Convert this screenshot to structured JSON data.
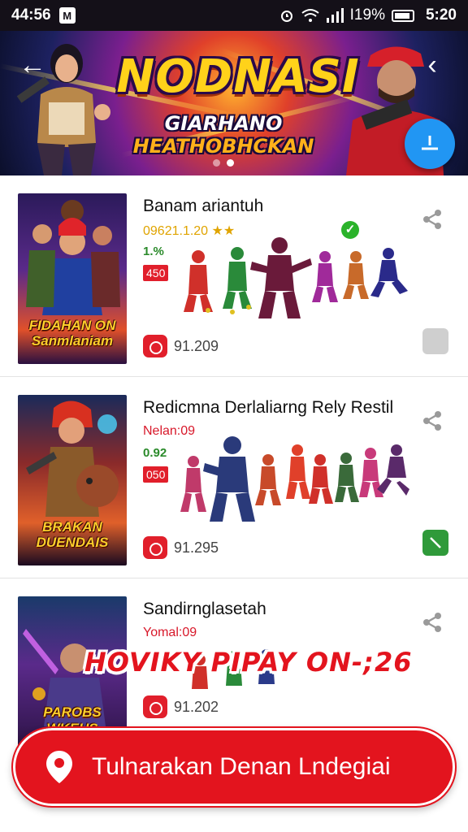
{
  "status_bar": {
    "time": "44:56",
    "notification_icon": "M",
    "battery": "I19%",
    "clock": "5:20",
    "icons": [
      "alarm-icon",
      "wifi-icon",
      "signal-icon",
      "battery-icon"
    ]
  },
  "banner": {
    "title": "NODNASI",
    "subtitle_part1": "GIARHANO ",
    "subtitle_part2": "HEATHOBHCKAN",
    "dots": 2,
    "active_dot": 1
  },
  "items": [
    {
      "title": "Banam ariantuh",
      "meta": "09621.1.20 ★★",
      "meta_color": "#e0a400",
      "pct": "1.%",
      "price": "450",
      "count": "91.209",
      "poster_title": "FIDAHAN ON Sanmlaniam",
      "action_style": "gray",
      "verified": true
    },
    {
      "title": "Redicmna Derlaliarng Rely Restil",
      "meta": "Nelan:09",
      "meta_color": "#d8182a",
      "pct": "0.92",
      "price": "050",
      "count": "91.295",
      "poster_title": "BRAKAN DUENDAIS",
      "action_style": "green",
      "verified": false
    },
    {
      "title": "Sandirnglasetah",
      "meta": "Yomal:09",
      "meta_color": "#d8182a",
      "pct": "",
      "price": "",
      "count": "91.202",
      "poster_title": "PAROBS WKEHS FIDADVAS",
      "action_style": "none",
      "verified": false
    }
  ],
  "promo_text": "HOVIKY PIPAY ON-;26",
  "cta": {
    "label": "Tulnarakan Denan Lndegiai"
  },
  "colors": {
    "accent_red": "#e3141e",
    "fab_blue": "#2196f3"
  }
}
